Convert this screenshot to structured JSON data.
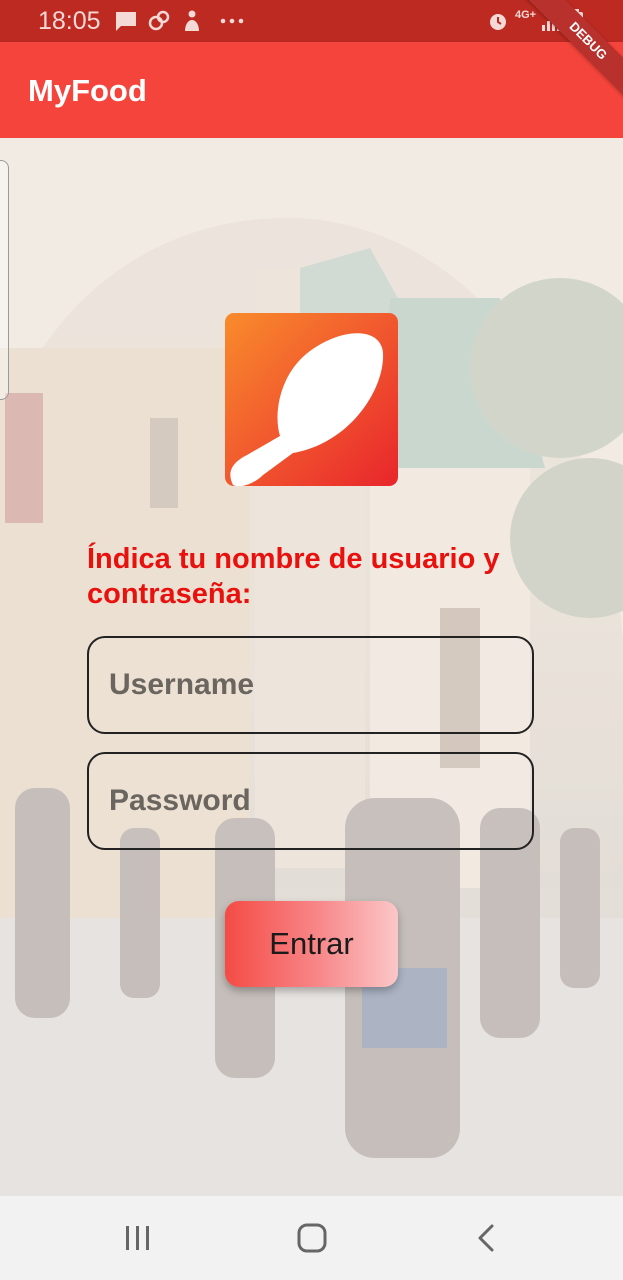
{
  "status_bar": {
    "time": "18:05",
    "icons": [
      "message-icon",
      "link-icon",
      "person-icon",
      "more-icon",
      "alarm-icon",
      "4g-icon",
      "signal-icon",
      "battery-icon"
    ],
    "network_label": "4G+"
  },
  "app_bar": {
    "title": "MyFood",
    "color": "#f4443b",
    "debug_label": "DEBUG"
  },
  "login": {
    "prompt": "Índica tu nombre de usuario y contraseña:",
    "prompt_color": "#e8110e",
    "username_placeholder": "Username",
    "password_placeholder": "Password",
    "submit_label": "Entrar"
  },
  "nav_bar": {
    "icons": [
      "recent-apps-icon",
      "home-icon",
      "back-icon"
    ]
  }
}
